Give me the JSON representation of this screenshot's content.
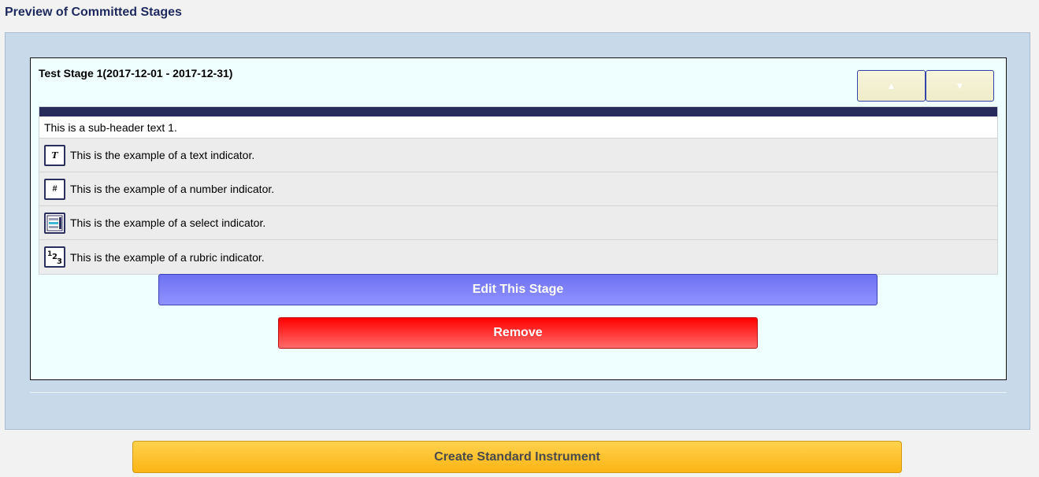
{
  "page": {
    "title": "Preview of Committed Stages"
  },
  "stage": {
    "title": "Test Stage 1(2017-12-01 - 2017-12-31)",
    "move_up_icon": "▲",
    "move_down_icon": "▼",
    "subheader": "This is a sub-header text 1.",
    "indicators": [
      {
        "icon": "text-icon",
        "glyph": "T",
        "label": "This is the example of a text indicator."
      },
      {
        "icon": "number-icon",
        "glyph": "#",
        "label": "This is the example of a number indicator."
      },
      {
        "icon": "select-icon",
        "glyph": "",
        "label": "This is the example of a select indicator."
      },
      {
        "icon": "rubric-icon",
        "glyph": "",
        "label": "This is the example of a rubric indicator."
      }
    ],
    "edit_label": "Edit This Stage",
    "remove_label": "Remove"
  },
  "footer": {
    "create_label": "Create Standard Instrument"
  },
  "colors": {
    "header_bar": "#262b5b",
    "edit_button": "#7679f5",
    "remove_button": "#ff2020",
    "create_button": "#fcc22a"
  }
}
